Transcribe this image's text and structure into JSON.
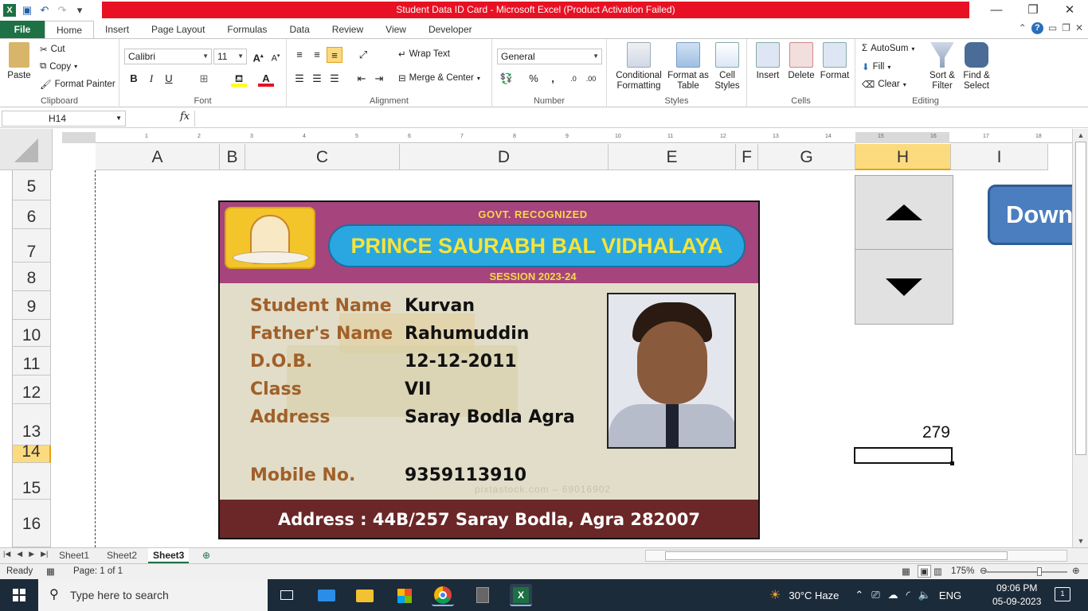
{
  "window": {
    "title": "Student Data ID Card  -  Microsoft Excel (Product Activation Failed)",
    "controls": [
      "—",
      "❐",
      "✕"
    ]
  },
  "ribbon_tabs": [
    "File",
    "Home",
    "Insert",
    "Page Layout",
    "Formulas",
    "Data",
    "Review",
    "View",
    "Developer"
  ],
  "active_tab": "Home",
  "clipboard": {
    "paste": "Paste",
    "cut": "Cut",
    "copy": "Copy",
    "format_painter": "Format Painter",
    "label": "Clipboard"
  },
  "font": {
    "name": "Calibri",
    "size": "11",
    "label": "Font",
    "bold": "B",
    "italic": "I",
    "underline": "U"
  },
  "alignment": {
    "wrap_text": "Wrap Text",
    "merge_center": "Merge & Center",
    "label": "Alignment"
  },
  "number": {
    "format": "General",
    "label": "Number",
    "percent": "%",
    "comma": ","
  },
  "styles": {
    "conditional": "Conditional Formatting",
    "format_table": "Format as Table",
    "cell_styles": "Cell Styles",
    "label": "Styles"
  },
  "cells": {
    "insert": "Insert",
    "delete": "Delete",
    "format": "Format",
    "label": "Cells"
  },
  "editing": {
    "autosum": "AutoSum",
    "fill": "Fill",
    "clear": "Clear",
    "sort_filter": "Sort & Filter",
    "find_select": "Find & Select",
    "label": "Editing"
  },
  "formula_bar": {
    "name_box": "H14",
    "fx": "fx",
    "content": ""
  },
  "columns": [
    "A",
    "B",
    "C",
    "D",
    "E",
    "F",
    "G",
    "H",
    "I"
  ],
  "rows": [
    "5",
    "6",
    "7",
    "8",
    "9",
    "10",
    "11",
    "12",
    "13",
    "14",
    "15",
    "16"
  ],
  "ruler_ticks": [
    "1",
    "2",
    "3",
    "4",
    "5",
    "6",
    "7",
    "8",
    "9",
    "10",
    "11",
    "12",
    "13",
    "14",
    "15",
    "16",
    "17",
    "18"
  ],
  "id_card": {
    "govt": "GOVT. RECOGNIZED",
    "school": "PRINCE SAURABH BAL VIDHALAYA",
    "session": "SESSION 2023-24",
    "fields": [
      {
        "label": "Student Name",
        "value": "Kurvan"
      },
      {
        "label": "Father's Name",
        "value": "Rahumuddin"
      },
      {
        "label": "D.O.B.",
        "value": "12-12-2011"
      },
      {
        "label": "Class",
        "value": "VII"
      },
      {
        "label": "Address",
        "value": "Saray Bodla Agra"
      },
      {
        "label": "Mobile No.",
        "value": "9359113910"
      }
    ],
    "watermark": "pixtastock.com – 69016902",
    "footer": "Address  :  44B/257 Saray Bodla, Agra 282007"
  },
  "download_button": "Down",
  "cell_value": "279",
  "sheets": [
    "Sheet1",
    "Sheet2",
    "Sheet3"
  ],
  "active_sheet": "Sheet3",
  "status": {
    "ready": "Ready",
    "page": "Page: 1 of 1",
    "zoom": "175%"
  },
  "taskbar": {
    "search_placeholder": "Type here to search",
    "weather": "30°C  Haze",
    "lang": "ENG",
    "time": "09:06 PM",
    "date": "05-09-2023",
    "notifications": "1"
  }
}
